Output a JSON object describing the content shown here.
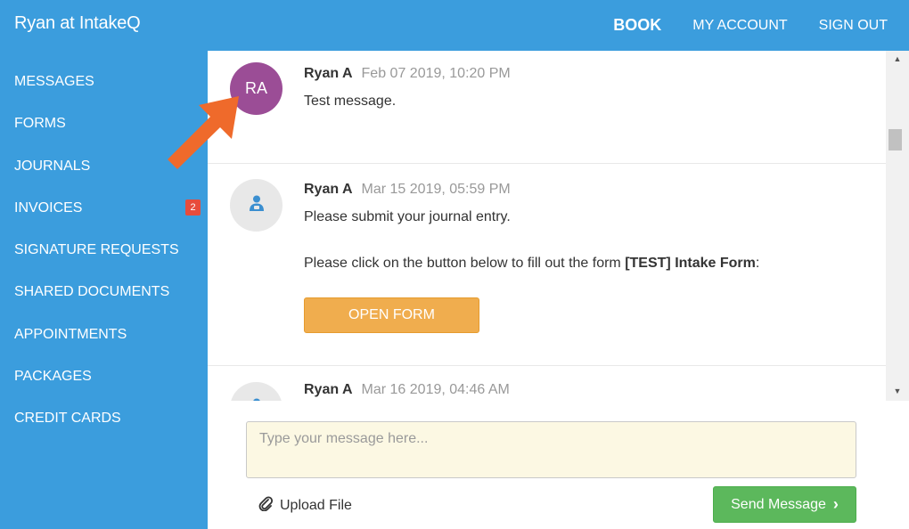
{
  "header": {
    "brand": "Ryan at IntakeQ",
    "nav": {
      "book": "BOOK",
      "account": "MY ACCOUNT",
      "signout": "SIGN OUT"
    }
  },
  "sidebar": {
    "items": [
      {
        "label": "MESSAGES"
      },
      {
        "label": "FORMS"
      },
      {
        "label": "JOURNALS"
      },
      {
        "label": "INVOICES",
        "badge": "2"
      },
      {
        "label": "SIGNATURE REQUESTS"
      },
      {
        "label": "SHARED DOCUMENTS"
      },
      {
        "label": "APPOINTMENTS"
      },
      {
        "label": "PACKAGES"
      },
      {
        "label": "CREDIT CARDS"
      }
    ]
  },
  "messages": [
    {
      "avatar_initials": "RA",
      "author": "Ryan A",
      "date": "Feb 07 2019, 10:20 PM",
      "text": "Test message."
    },
    {
      "avatar_icon": "user-badge-icon",
      "author": "Ryan A",
      "date": "Mar 15 2019, 05:59 PM",
      "text": "Please submit your journal entry.",
      "form_prompt": "Please click on the button below to fill out the form ",
      "form_name": "[TEST] Intake Form",
      "form_suffix": ":",
      "button_label": "OPEN FORM"
    },
    {
      "avatar_icon": "user-badge-icon",
      "author": "Ryan A",
      "date": "Mar 16 2019, 04:46 AM"
    }
  ],
  "composer": {
    "placeholder": "Type your message here...",
    "upload_label": "Upload File",
    "send_label": "Send Message"
  },
  "colors": {
    "brand_blue": "#3b9ddd",
    "avatar_purple": "#9b4d96",
    "button_orange": "#f0ad4e",
    "send_green": "#5cb85c",
    "badge_red": "#e74c3c",
    "annotation_orange": "#ef6a2b",
    "input_bg": "#fcf8e3"
  }
}
